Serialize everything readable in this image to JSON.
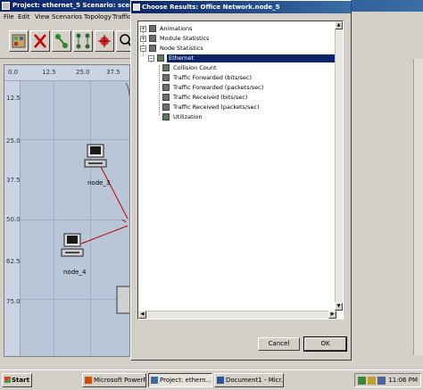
{
  "main_window": {
    "title": "Project: ethernet_5 Scenario: scenario"
  },
  "menu": [
    "File",
    "Edit",
    "View",
    "Scenarios",
    "Topology",
    "Traffic"
  ],
  "workspace": {
    "ruler_top": [
      "0.0",
      "12.5",
      "25.0",
      "37.5"
    ],
    "ruler_left": [
      "12.5",
      "25.0",
      "37.5",
      "50.0",
      "62.5",
      "75.0"
    ],
    "nodes": [
      {
        "label": "node_3"
      },
      {
        "label": "node_4"
      }
    ]
  },
  "dialog": {
    "title": "Choose Results: Office Network.node_5",
    "tree": [
      {
        "label": "Animations",
        "level": 0,
        "expander": "+"
      },
      {
        "label": "Module Statistics",
        "level": 0,
        "expander": "+"
      },
      {
        "label": "Node Statistics",
        "level": 0,
        "expander": "−"
      },
      {
        "label": "Ethernet",
        "level": 1,
        "expander": "−",
        "selected": true
      },
      {
        "label": "Collision Count",
        "level": 2,
        "checked": true
      },
      {
        "label": "Traffic Forwarded (bits/sec)",
        "level": 2,
        "checked": false
      },
      {
        "label": "Traffic Forwarded (packets/sec)",
        "level": 2,
        "checked": false
      },
      {
        "label": "Traffic Received (bits/sec)",
        "level": 2,
        "checked": false
      },
      {
        "label": "Traffic Received (packets/sec)",
        "level": 2,
        "checked": false
      },
      {
        "label": "Utilization",
        "level": 2,
        "checked": true
      }
    ],
    "cancel_label": "Cancel",
    "ok_label": "OK"
  },
  "taskbar": {
    "start_label": "Start",
    "tasks": [
      {
        "label": "Microsoft PowerP...",
        "active": false
      },
      {
        "label": "Project: ethern...",
        "active": true
      },
      {
        "label": "Document1 - Micr...",
        "active": false
      }
    ],
    "clock": "11:06 PM"
  }
}
